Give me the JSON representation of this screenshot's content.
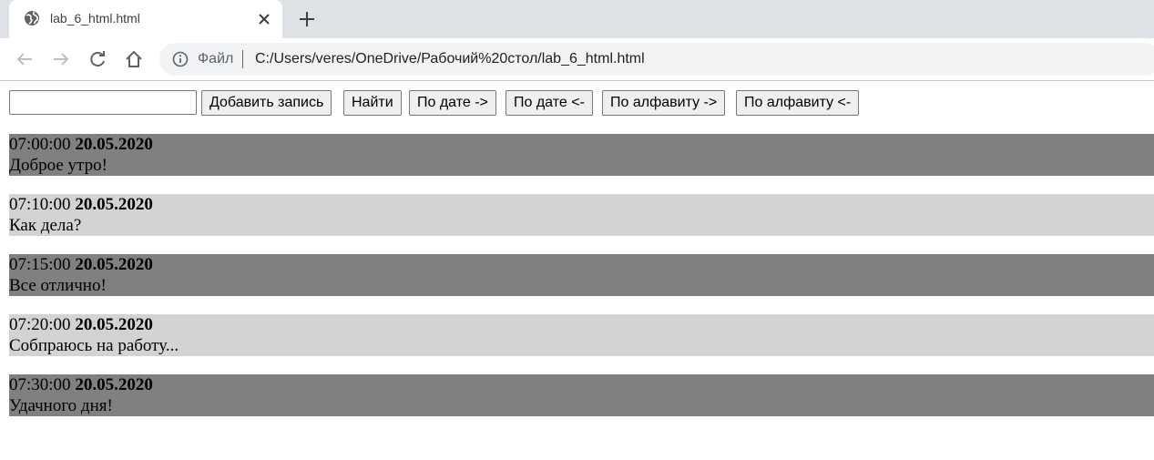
{
  "browser": {
    "tab_title": "lab_6_html.html",
    "scheme_label": "Файл",
    "url": "C:/Users/veres/OneDrive/Рабочий%20стол/lab_6_html.html",
    "icons": [
      "globe-icon",
      "close-icon",
      "plus-icon",
      "back-icon",
      "forward-icon",
      "reload-icon",
      "home-icon",
      "info-icon"
    ]
  },
  "controls": {
    "input_value": "",
    "add_label": "Добавить запись",
    "find_label": "Найти",
    "sort_date_asc_label": "По дате ->",
    "sort_date_desc_label": "По дате <-",
    "sort_alpha_asc_label": "По алфавиту ->",
    "sort_alpha_desc_label": "По алфавиту <-"
  },
  "entries": [
    {
      "time": "07:00:00",
      "date": "20.05.2020",
      "text": "Доброе утро!",
      "shade": "dark"
    },
    {
      "time": "07:10:00",
      "date": "20.05.2020",
      "text": "Как дела?",
      "shade": "light"
    },
    {
      "time": "07:15:00",
      "date": "20.05.2020",
      "text": "Все отлично!",
      "shade": "dark"
    },
    {
      "time": "07:20:00",
      "date": "20.05.2020",
      "text": "Собпраюсь на работу...",
      "shade": "light"
    },
    {
      "time": "07:30:00",
      "date": "20.05.2020",
      "text": "Удачного дня!",
      "shade": "dark"
    }
  ],
  "colors": {
    "dark_row": "#808080",
    "light_row": "#d3d3d3",
    "tabstrip": "#dee1e6",
    "omnibox": "#f1f3f4"
  }
}
